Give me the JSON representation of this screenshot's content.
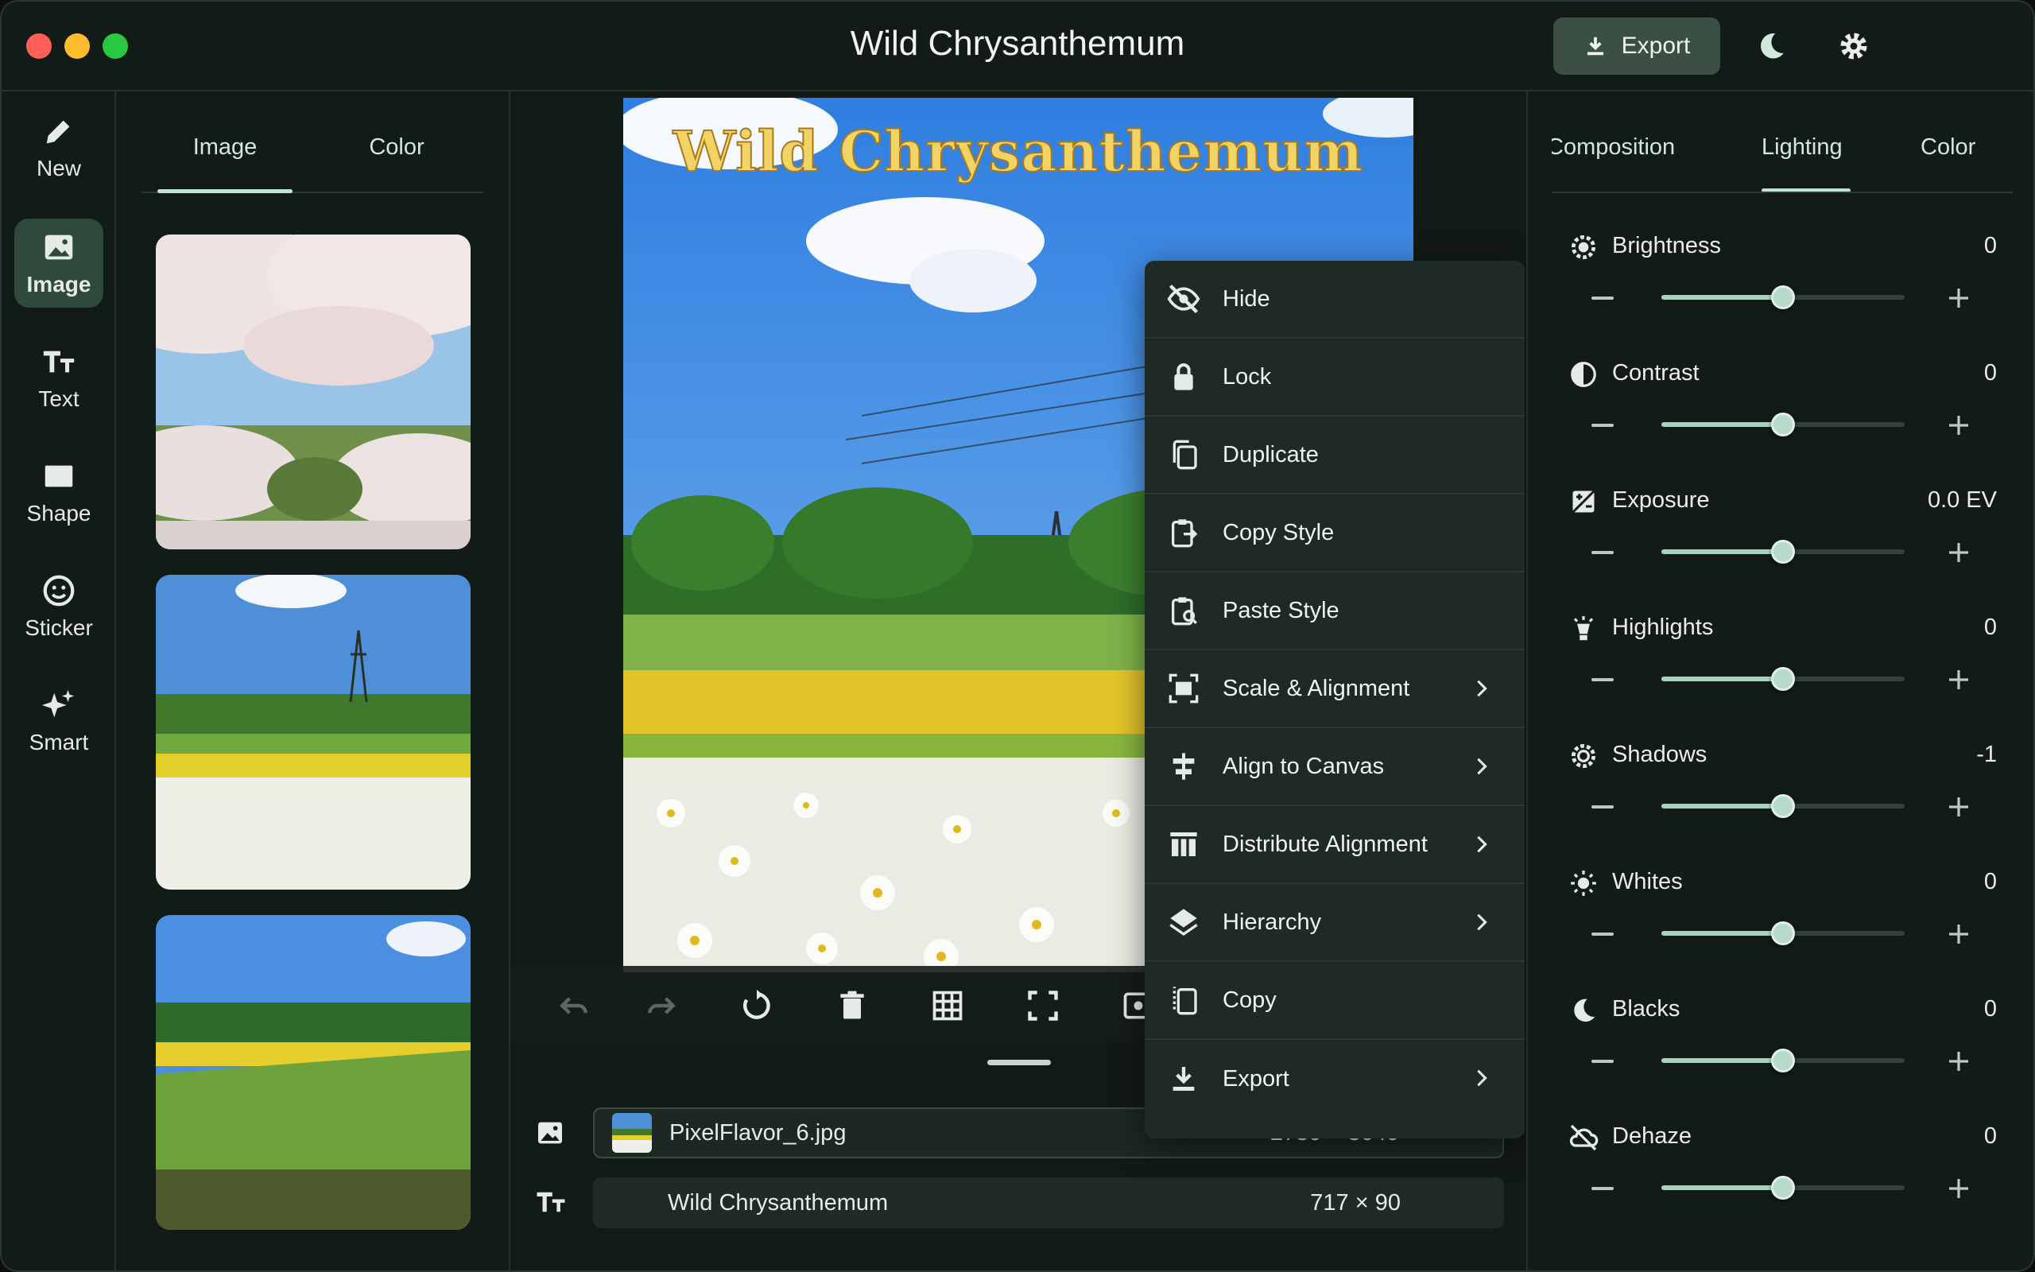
{
  "window": {
    "title": "Wild Chrysanthemum",
    "export_label": "Export"
  },
  "rail": {
    "items": [
      {
        "label": "New",
        "icon": "pencil-icon"
      },
      {
        "label": "Image",
        "icon": "image-icon",
        "active": true
      },
      {
        "label": "Text",
        "icon": "text-icon"
      },
      {
        "label": "Shape",
        "icon": "shape-icon"
      },
      {
        "label": "Sticker",
        "icon": "smiley-icon"
      },
      {
        "label": "Smart",
        "icon": "sparkle-icon"
      }
    ]
  },
  "left_panel": {
    "tabs": [
      {
        "label": "Image",
        "active": true
      },
      {
        "label": "Color"
      }
    ]
  },
  "canvas": {
    "overlay_title": "Wild Chrysanthemum"
  },
  "layers": [
    {
      "name": "PixelFlavor_6.jpg",
      "size": "2730 × 3640",
      "type": "image"
    },
    {
      "name": "Wild Chrysanthemum",
      "size": "717 × 90",
      "type": "text"
    }
  ],
  "context_menu": {
    "items": [
      {
        "label": "Hide",
        "icon": "eye-off-icon",
        "submenu": false
      },
      {
        "label": "Lock",
        "icon": "lock-icon",
        "submenu": false
      },
      {
        "label": "Duplicate",
        "icon": "duplicate-icon",
        "submenu": false
      },
      {
        "label": "Copy Style",
        "icon": "copy-style-icon",
        "submenu": false
      },
      {
        "label": "Paste Style",
        "icon": "paste-style-icon",
        "submenu": false
      },
      {
        "label": "Scale & Alignment",
        "icon": "scale-icon",
        "submenu": true
      },
      {
        "label": "Align to Canvas",
        "icon": "align-canvas-icon",
        "submenu": true
      },
      {
        "label": "Distribute Alignment",
        "icon": "distribute-icon",
        "submenu": true
      },
      {
        "label": "Hierarchy",
        "icon": "layers-icon",
        "submenu": true
      },
      {
        "label": "Copy",
        "icon": "copy-icon",
        "submenu": false
      },
      {
        "label": "Export",
        "icon": "download-icon",
        "submenu": true
      }
    ]
  },
  "right_panel": {
    "tabs": [
      {
        "label": "Composition"
      },
      {
        "label": "Lighting",
        "active": true
      },
      {
        "label": "Color"
      }
    ],
    "adjustments": [
      {
        "label": "Brightness",
        "value": "0",
        "icon": "brightness-icon",
        "level": 0.5
      },
      {
        "label": "Contrast",
        "value": "0",
        "icon": "contrast-icon",
        "level": 0.5
      },
      {
        "label": "Exposure",
        "value": "0.0 EV",
        "icon": "exposure-icon",
        "level": 0.5
      },
      {
        "label": "Highlights",
        "value": "0",
        "icon": "highlights-icon",
        "level": 0.5
      },
      {
        "label": "Shadows",
        "value": "-1",
        "icon": "shadows-icon",
        "level": 0.5
      },
      {
        "label": "Whites",
        "value": "0",
        "icon": "whites-icon",
        "level": 0.5
      },
      {
        "label": "Blacks",
        "value": "0",
        "icon": "blacks-icon",
        "level": 0.5
      },
      {
        "label": "Dehaze",
        "value": "0",
        "icon": "dehaze-icon",
        "level": 0.5
      }
    ]
  },
  "colors": {
    "accent": "#bfe3cf",
    "panel": "#121b17",
    "selected": "#2f4a3d"
  }
}
